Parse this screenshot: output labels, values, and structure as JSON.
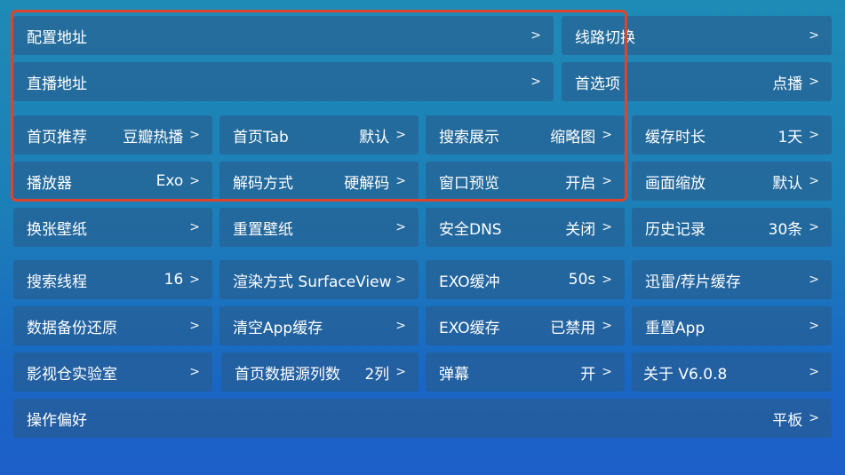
{
  "arrow": ">",
  "tiles": [
    {
      "id": "config-address",
      "label": "配置地址",
      "value": ""
    },
    {
      "id": "line-switch",
      "label": "线路切换",
      "value": ""
    },
    {
      "id": "live-address",
      "label": "直播地址",
      "value": ""
    },
    {
      "id": "preferred-option",
      "label": "首选项",
      "value": "点播"
    },
    {
      "id": "home-recommend",
      "label": "首页推荐",
      "value": "豆瓣热播"
    },
    {
      "id": "home-tab",
      "label": "首页Tab",
      "value": "默认"
    },
    {
      "id": "search-display",
      "label": "搜索展示",
      "value": "缩略图"
    },
    {
      "id": "cache-duration",
      "label": "缓存时长",
      "value": "1天"
    },
    {
      "id": "player",
      "label": "播放器",
      "value": "Exo"
    },
    {
      "id": "decode-mode",
      "label": "解码方式",
      "value": "硬解码"
    },
    {
      "id": "window-preview",
      "label": "窗口预览",
      "value": "开启"
    },
    {
      "id": "screen-scale",
      "label": "画面缩放",
      "value": "默认"
    },
    {
      "id": "change-wallpaper",
      "label": "换张壁纸",
      "value": ""
    },
    {
      "id": "reset-wallpaper",
      "label": "重置壁纸",
      "value": ""
    },
    {
      "id": "secure-dns",
      "label": "安全DNS",
      "value": "关闭"
    },
    {
      "id": "history",
      "label": "历史记录",
      "value": "30条"
    },
    {
      "id": "search-threads",
      "label": "搜索线程",
      "value": "16"
    },
    {
      "id": "render-mode",
      "label": "渲染方式 SurfaceView",
      "value": ""
    },
    {
      "id": "exo-buffer",
      "label": "EXO缓冲",
      "value": "50s"
    },
    {
      "id": "thunder-cache",
      "label": "迅雷/荐片缓存",
      "value": ""
    },
    {
      "id": "data-backup",
      "label": "数据备份还原",
      "value": ""
    },
    {
      "id": "clear-app-cache",
      "label": "清空App缓存",
      "value": ""
    },
    {
      "id": "exo-cache",
      "label": "EXO缓存",
      "value": "已禁用"
    },
    {
      "id": "reset-app",
      "label": "重置App",
      "value": ""
    },
    {
      "id": "lab",
      "label": "影视仓实验室",
      "value": ""
    },
    {
      "id": "home-source-columns",
      "label": "首页数据源列数",
      "value": "2列"
    },
    {
      "id": "danmaku",
      "label": "弹幕",
      "value": "开"
    },
    {
      "id": "about",
      "label": "关于 V6.0.8",
      "value": ""
    },
    {
      "id": "operation-preference",
      "label": "操作偏好",
      "value": "平板"
    }
  ]
}
